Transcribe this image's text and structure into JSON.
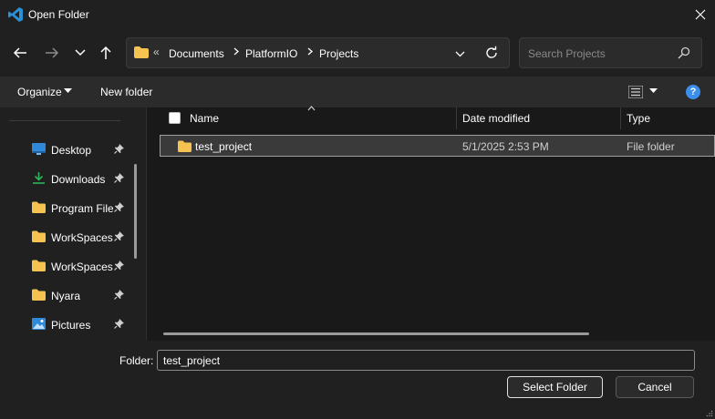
{
  "window": {
    "title": "Open Folder",
    "icon": "vscode-icon"
  },
  "address": {
    "breadcrumbs": [
      "Documents",
      "PlatformIO",
      "Projects"
    ],
    "overflow_glyph": "«"
  },
  "search": {
    "placeholder": "Search Projects"
  },
  "toolbar": {
    "organize_label": "Organize",
    "new_folder_label": "New folder"
  },
  "sidebar": {
    "items": [
      {
        "label": "Desktop",
        "icon": "desktop-icon"
      },
      {
        "label": "Downloads",
        "icon": "download-icon"
      },
      {
        "label": "Program Files",
        "icon": "folder-icon"
      },
      {
        "label": "WorkSpaces",
        "icon": "folder-icon"
      },
      {
        "label": "WorkSpaces",
        "icon": "folder-icon"
      },
      {
        "label": "Nyara",
        "icon": "folder-icon"
      },
      {
        "label": "Pictures",
        "icon": "pictures-icon"
      }
    ]
  },
  "filelist": {
    "columns": [
      "Name",
      "Date modified",
      "Type"
    ],
    "rows": [
      {
        "name": "test_project",
        "date": "5/1/2025 2:53 PM",
        "type": "File folder"
      }
    ]
  },
  "footer": {
    "folder_label": "Folder:",
    "folder_value": "test_project",
    "select_label": "Select Folder",
    "cancel_label": "Cancel"
  },
  "colors": {
    "background": "#202020",
    "folder": "#f6c350",
    "accent": "#3b8eea"
  }
}
